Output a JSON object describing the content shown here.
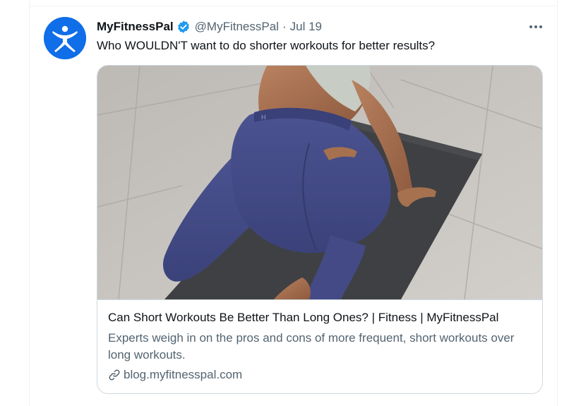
{
  "tweet": {
    "display_name": "MyFitnessPal",
    "handle": "@MyFitnessPal",
    "separator": "·",
    "date": "Jul 19",
    "text": "Who WOULDN'T want to do shorter workouts for better results?",
    "avatar_icon": "myfitnesspal-logo",
    "verified_icon": "verified-badge-icon",
    "more_icon": "more-options-icon"
  },
  "card": {
    "title": "Can Short Workouts Be Better Than Long Ones? | Fitness | MyFitnessPal",
    "description": "Experts weigh in on the pros and cons of more frequent, short workouts over long workouts.",
    "domain": "blog.myfitnesspal.com",
    "domain_icon": "link-icon",
    "image_subject": "workout-photo"
  },
  "colors": {
    "text_primary": "#0f1419",
    "text_secondary": "#536471",
    "verified_blue": "#1d9bf0",
    "avatar_blue": "#0f6ee8",
    "border": "#cfd9de"
  }
}
